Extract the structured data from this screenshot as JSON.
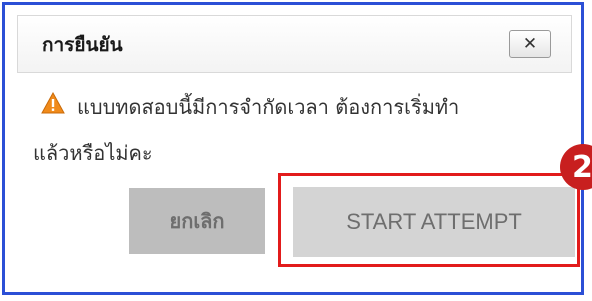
{
  "dialog": {
    "title": "การยืนยัน",
    "close_label": "✕",
    "message_line1": "แบบทดสอบนี้มีการจำกัดเวลา ต้องการเริ่มทำ",
    "message_line2": "แล้วหรือไม่คะ",
    "warning_icon": "warning-triangle-icon",
    "cancel_label": "ยกเลิก",
    "start_label": "START ATTEMPT"
  },
  "annotation": {
    "step_number": "2",
    "highlight_color": "#e21b1b"
  },
  "colors": {
    "dialog_border": "#2b4fd6",
    "warning": "#f08a1a",
    "button_bg": "#d4d4d4"
  }
}
